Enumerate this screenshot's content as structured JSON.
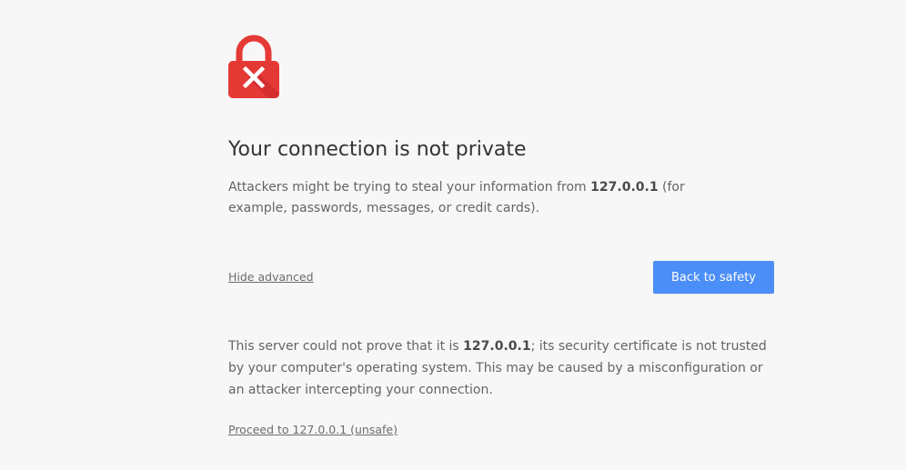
{
  "icon": {
    "name": "lock-error-icon",
    "color": "#e53935",
    "x_color": "#ffffff"
  },
  "heading": "Your connection is not private",
  "summary": {
    "prefix": "Attackers might be trying to steal your information from ",
    "host": "127.0.0.1",
    "suffix": " (for example, passwords, messages, or credit cards)."
  },
  "actions": {
    "hide_advanced": "Hide advanced",
    "back_to_safety": "Back to safety",
    "button_color": "#4c8ef7"
  },
  "details": {
    "prefix": "This server could not prove that it is ",
    "host": "127.0.0.1",
    "suffix": "; its security certificate is not trusted by your computer's operating system. This may be caused by a misconfiguration or an attacker intercepting your connection."
  },
  "proceed_link": "Proceed to 127.0.0.1 (unsafe)"
}
